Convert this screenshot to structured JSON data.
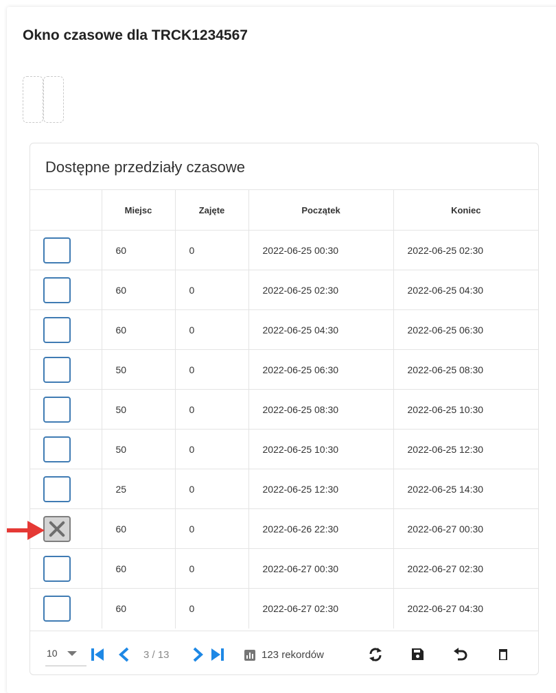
{
  "window": {
    "title": "Okno czasowe dla TRCK1234567"
  },
  "grid": {
    "title": "Dostępne przedziały czasowe",
    "columns": [
      "",
      "Miejsc",
      "Zajęte",
      "Początek",
      "Koniec"
    ],
    "rows": [
      {
        "checked": false,
        "miejsc": "60",
        "zajete": "0",
        "poczatek": "2022-06-25 00:30",
        "koniec": "2022-06-25 02:30"
      },
      {
        "checked": false,
        "miejsc": "60",
        "zajete": "0",
        "poczatek": "2022-06-25 02:30",
        "koniec": "2022-06-25 04:30"
      },
      {
        "checked": false,
        "miejsc": "60",
        "zajete": "0",
        "poczatek": "2022-06-25 04:30",
        "koniec": "2022-06-25 06:30"
      },
      {
        "checked": false,
        "miejsc": "50",
        "zajete": "0",
        "poczatek": "2022-06-25 06:30",
        "koniec": "2022-06-25 08:30"
      },
      {
        "checked": false,
        "miejsc": "50",
        "zajete": "0",
        "poczatek": "2022-06-25 08:30",
        "koniec": "2022-06-25 10:30"
      },
      {
        "checked": false,
        "miejsc": "50",
        "zajete": "0",
        "poczatek": "2022-06-25 10:30",
        "koniec": "2022-06-25 12:30"
      },
      {
        "checked": false,
        "miejsc": "25",
        "zajete": "0",
        "poczatek": "2022-06-25 12:30",
        "koniec": "2022-06-25 14:30"
      },
      {
        "checked": true,
        "miejsc": "60",
        "zajete": "0",
        "poczatek": "2022-06-26 22:30",
        "koniec": "2022-06-27 00:30"
      },
      {
        "checked": false,
        "miejsc": "60",
        "zajete": "0",
        "poczatek": "2022-06-27 00:30",
        "koniec": "2022-06-27 02:30"
      },
      {
        "checked": false,
        "miejsc": "60",
        "zajete": "0",
        "poczatek": "2022-06-27 02:30",
        "koniec": "2022-06-27 04:30"
      }
    ]
  },
  "pager": {
    "page_size": "10",
    "page_info": "3 / 13",
    "records": "123 rekordów",
    "icons": [
      "first-page-icon",
      "prev-page-icon",
      "next-page-icon",
      "last-page-icon",
      "records-chart-icon",
      "refresh-icon",
      "save-icon",
      "undo-icon",
      "delete-icon"
    ]
  },
  "colors": {
    "accent": "#1e88e5",
    "checkbox_border": "#3f7bb3",
    "arrow": "#e53935"
  }
}
